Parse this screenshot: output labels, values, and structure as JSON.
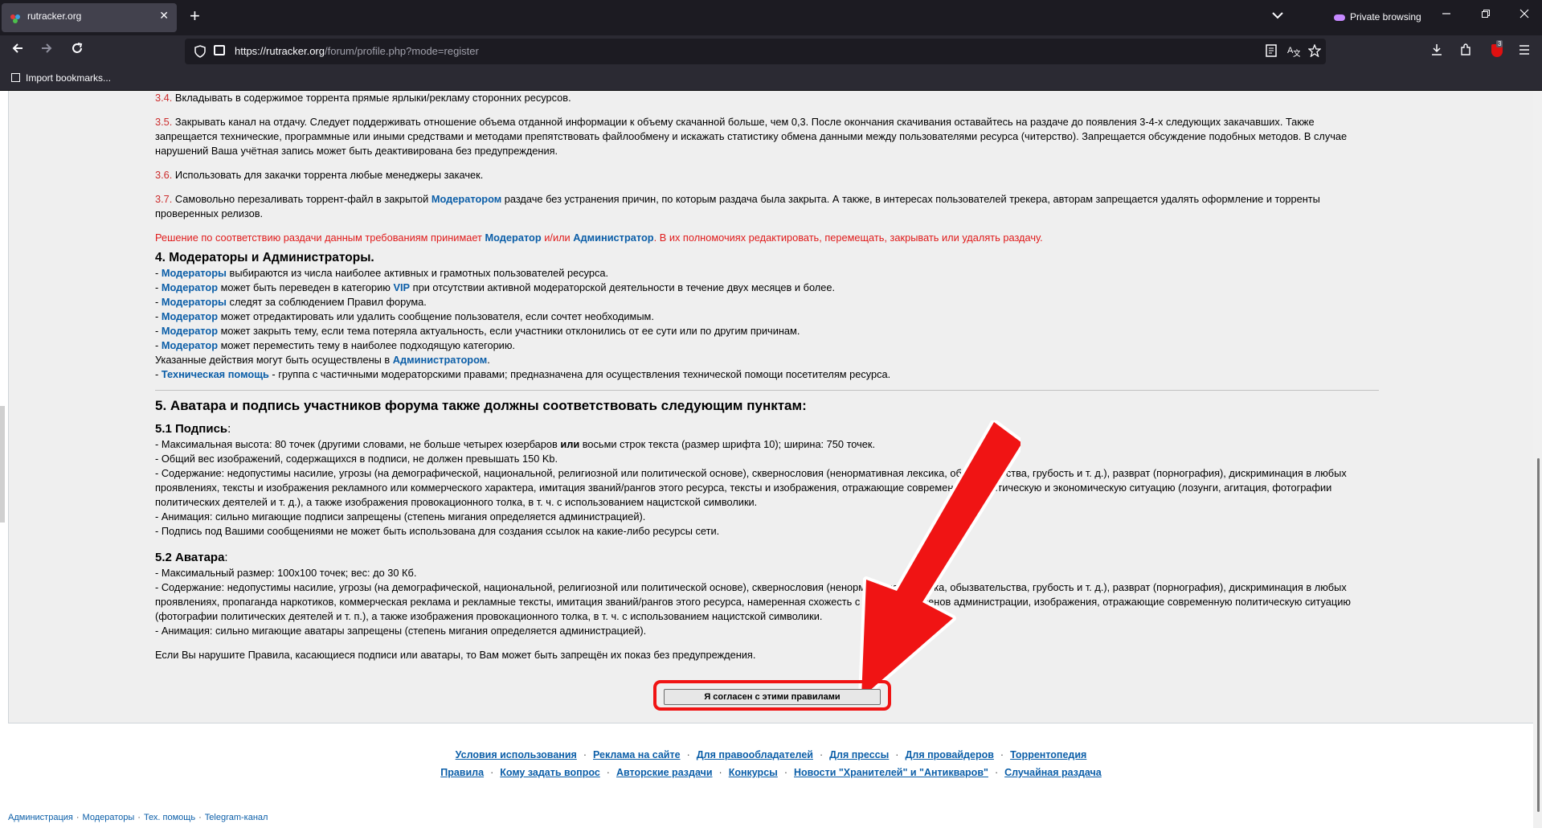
{
  "browser": {
    "tab_title": "rutracker.org",
    "close_symbol": "✕",
    "new_tab_symbol": "+",
    "list_all_symbol": "⌄",
    "private_label": "Private browsing",
    "url_host": "https://rutracker.org",
    "url_path": "/forum/profile.php?mode=register",
    "bookmarks_label": "Import bookmarks...",
    "ublock_count": "3",
    "icons": [
      "back-icon",
      "forward-icon",
      "reload-icon",
      "shield-icon",
      "lock-icon",
      "reader-icon",
      "translate-icon",
      "star-icon",
      "download-icon",
      "extensions-icon",
      "ublock-icon",
      "menu-icon"
    ]
  },
  "rules": {
    "p34_num": "3.4.",
    "p34_text": " Вкладывать в содержимое торрента прямые ярлыки/рекламу сторонних ресурсов.",
    "p35_num": "3.5.",
    "p35_text": " Закрывать канал на отдачу. Следует поддерживать отношение объема отданной информации к объему скачанной больше, чем 0,3. После окончания скачивания оставайтесь на раздаче до появления 3-4-х следующих закачавших. Также запрещается технические, программные или иными средствами и методами препятствовать файлообмену и искажать статистику обмена данными между пользователями ресурса (читерство). Запрещается обсуждение подобных методов. В случае нарушений Ваша учётная запись может быть деактивирована без предупреждения.",
    "p36_num": "3.6.",
    "p36_text": " Использовать для закачки торрента любые менеджеры закачек.",
    "p37_num": "3.7.",
    "p37_text_a": " Самовольно перезаливать торрент-файл в закрытой ",
    "p37_link": "Модератором",
    "p37_text_b": " раздаче без устранения причин, по которым раздача была закрыта. А также, в интересах пользователей трекера, авторам запрещается удалять оформление и торренты проверенных релизов.",
    "decision_a": "Решение по соответствию раздачи данным требованиям принимает ",
    "decision_link1": "Модератор",
    "decision_b": " и/или ",
    "decision_link2": "Администратор",
    "decision_c": ". В их полномочиях редактировать, перемещать, закрывать или удалять раздачу.",
    "h4": "4. Модераторы и Администраторы.",
    "mod_lines": [
      {
        "dash": "- ",
        "link": "Модераторы",
        "text": " выбираются из числа наиболее активных и грамотных пользователей ресурса."
      },
      {
        "dash": "- ",
        "link": "Модератор",
        "text": " может быть переведен в категорию ",
        "link2": "VIP",
        "text2": " при отсутствии активной модераторской деятельности в течение двух месяцев и более."
      },
      {
        "dash": "- ",
        "link": "Модераторы",
        "text": " следят за соблюдением Правил форума."
      },
      {
        "dash": "- ",
        "link": "Модератор",
        "text": " может отредактировать или удалить сообщение пользователя, если сочтет необходимым."
      },
      {
        "dash": "- ",
        "link": "Модератор",
        "text": " может закрыть тему, если тема потеряла актуальность, если участники отклонились от ее сути или по другим причинам."
      },
      {
        "dash": "- ",
        "link": "Модератор",
        "text": " может переместить тему в наиболее подходящую категорию."
      }
    ],
    "actions_text": "Указанные действия могут быть осуществлены в ",
    "actions_link": "Администратором",
    "actions_end": ".",
    "tech_dash": "- ",
    "tech_link": "Техническая помощь",
    "tech_text": " - группа с частичными модераторскими правами; предназначена для осуществления технической помощи посетителям ресурса.",
    "h5": "5. Аватара и подпись участников форума также должны соответствовать следующим пунктам:",
    "sig_head": "5.1 Подпись",
    "sig_colon": ":",
    "sig_line1_a": "- Максимальная высота: 80 точек (другими словами, не больше четырех юзербаров ",
    "sig_line1_bold": "или",
    "sig_line1_b": " восьми строк текста (размер шрифта 10); ширина: 750 точек.",
    "sig_line2": "- Общий вес изображений, содержащихся в подписи, не должен превышать 150 Kb.",
    "sig_line3": "- Содержание: недопустимы насилие, угрозы (на демографической, национальной, религиозной или политической основе), сквернословия (ненормативная лексика, обызвательства, грубость и т. д.), разврат (порнография), дискриминация в любых проявлениях, тексты и изображения рекламного или коммерческого характера, имитация званий/рангов этого ресурса, тексты и изображения, отражающие современную политическую и экономическую ситуацию (лозунги, агитация, фотографии политических деятелей и т. д.), а также изображения провокационного толка, в т. ч. с использованием нацистской символики.",
    "sig_line4": "- Анимация: сильно мигающие подписи запрещены (степень мигания определяется администрацией).",
    "sig_line5": "- Подпись под Вашими сообщениями не может быть использована для создания ссылок на какие-либо ресурсы сети.",
    "ava_head": "5.2 Аватара",
    "ava_colon": ":",
    "ava_line1": "- Максимальный размер: 100x100 точек; вес: до 30 Кб.",
    "ava_line2": "- Содержание: недопустимы насилие, угрозы (на демографической, национальной, религиозной или политической основе), сквернословия (ненормативная лексика, обызвательства, грубость и т. д.), разврат (порнография), дискриминация в любых проявлениях, пропаганда наркотиков, коммерческая реклама и рекламные тексты, имитация званий/рангов этого ресурса, намеренная схожесть с аватарами членов администрации, изображения, отражающие современную политическую ситуацию (фотографии политических деятелей и т. п.), а также изображения провокационного толка, в т. ч. с использованием нацистской символики.",
    "ava_line3": "- Анимация: сильно мигающие аватары запрещены (степень мигания определяется администрацией).",
    "warning": "Если Вы нарушите Правила, касающиеся подписи или аватары, то Вам может быть запрещён их показ без предупреждения."
  },
  "agree_button": "Я согласен с этими правилами",
  "footer": {
    "separator": "·",
    "row1": [
      "Условия использования",
      "Реклама на сайте",
      "Для правообладателей",
      "Для прессы",
      "Для провайдеров",
      "Торрентопедия"
    ],
    "row2": [
      "Правила",
      "Кому задать вопрос",
      "Авторские раздачи",
      "Конкурсы",
      "Новости \"Хранителей\" и \"Антикваров\"",
      "Случайная раздача"
    ],
    "bottom": [
      "Администрация",
      "Модераторы",
      "Тех. помощь",
      "Telegram-канал"
    ]
  },
  "colors": {
    "accent_red": "#e01b1b",
    "link_blue": "#0b5ea8",
    "arrow_red": "#f01414"
  }
}
